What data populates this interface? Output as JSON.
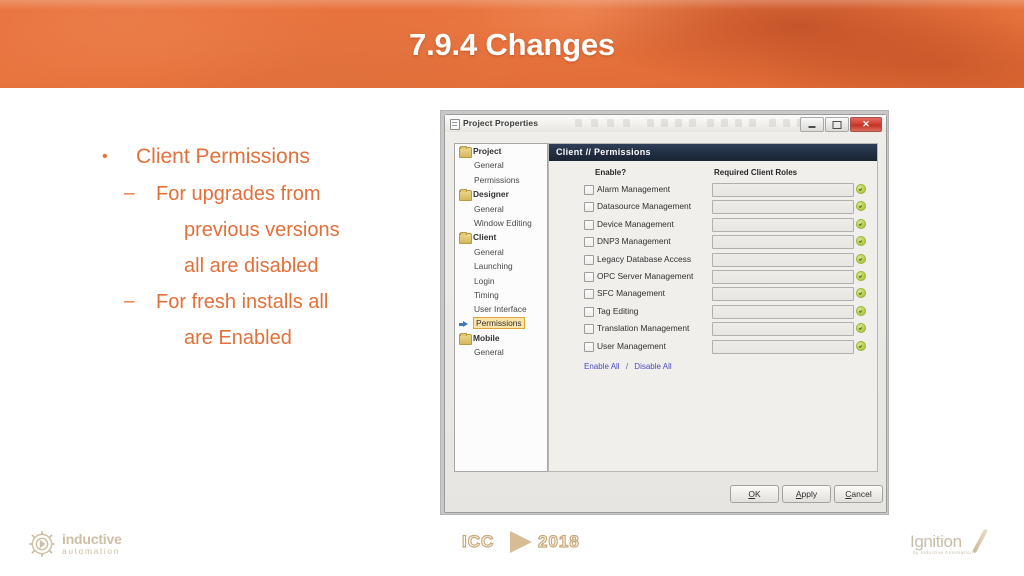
{
  "slide": {
    "title": "7.9.4 Changes"
  },
  "bullets": {
    "level1": "Client Permissions",
    "dot": "•",
    "dash": "–",
    "items": [
      {
        "line1": "For upgrades from",
        "line2": "previous versions",
        "line3": "all are disabled"
      },
      {
        "line1": "For fresh installs all",
        "line2": "are Enabled"
      }
    ]
  },
  "dialog": {
    "title": "Project Properties",
    "window_buttons": {
      "minimize": "minimize-button",
      "maximize": "maximize-button",
      "close": "✕"
    },
    "tree": [
      {
        "label": "Project",
        "type": "folder",
        "selected": false
      },
      {
        "label": "General",
        "type": "leaf",
        "selected": false
      },
      {
        "label": "Permissions",
        "type": "leaf",
        "selected": false
      },
      {
        "label": "Designer",
        "type": "folder",
        "selected": false
      },
      {
        "label": "General",
        "type": "leaf",
        "selected": false
      },
      {
        "label": "Window Editing",
        "type": "leaf",
        "selected": false
      },
      {
        "label": "Client",
        "type": "folder",
        "selected": false
      },
      {
        "label": "General",
        "type": "leaf",
        "selected": false
      },
      {
        "label": "Launching",
        "type": "leaf",
        "selected": false
      },
      {
        "label": "Login",
        "type": "leaf",
        "selected": false
      },
      {
        "label": "Timing",
        "type": "leaf",
        "selected": false
      },
      {
        "label": "User Interface",
        "type": "leaf",
        "selected": false
      },
      {
        "label": "Permissions",
        "type": "leaf",
        "selected": true
      },
      {
        "label": "Mobile",
        "type": "folder",
        "selected": false
      },
      {
        "label": "General",
        "type": "leaf",
        "selected": false
      }
    ],
    "content_header": "Client // Permissions",
    "columns": {
      "enable": "Enable?",
      "roles": "Required Client Roles"
    },
    "permissions": [
      {
        "label": "Alarm Management",
        "checked": false,
        "roles": ""
      },
      {
        "label": "Datasource Management",
        "checked": false,
        "roles": ""
      },
      {
        "label": "Device Management",
        "checked": false,
        "roles": ""
      },
      {
        "label": "DNP3 Management",
        "checked": false,
        "roles": ""
      },
      {
        "label": "Legacy Database Access",
        "checked": false,
        "roles": ""
      },
      {
        "label": "OPC Server Management",
        "checked": false,
        "roles": ""
      },
      {
        "label": "SFC Management",
        "checked": false,
        "roles": ""
      },
      {
        "label": "Tag Editing",
        "checked": false,
        "roles": ""
      },
      {
        "label": "Translation Management",
        "checked": false,
        "roles": ""
      },
      {
        "label": "User Management",
        "checked": false,
        "roles": ""
      }
    ],
    "toggle_links": {
      "enable_all": "Enable All",
      "separator": "/",
      "disable_all": "Disable All"
    },
    "buttons": {
      "ok": "OK",
      "apply": "Apply",
      "cancel": "Cancel"
    }
  },
  "footer": {
    "inductive": {
      "name": "inductive",
      "sub": "automation"
    },
    "icc": {
      "text": "ICC",
      "year": "2018"
    },
    "ignition": {
      "name": "Ignition",
      "sub": "by Inductive Automation"
    }
  },
  "colors": {
    "header_orange": "#e8703c",
    "bullet_orange": "#e2703a",
    "content_header_navy": "#1d2a3f",
    "link_blue": "#4a4ac2",
    "selection_yellow": "#fde7a9",
    "status_green": "#b7cf4e",
    "logo_tan": "#cdbfa6"
  }
}
